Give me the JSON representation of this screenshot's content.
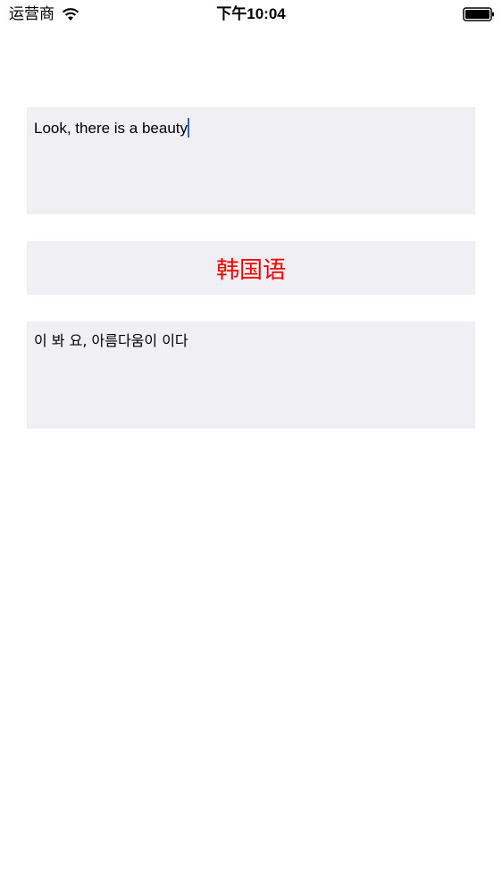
{
  "status_bar": {
    "carrier": "运营商",
    "time": "下午10:04",
    "icons": [
      "wifi-icon",
      "battery-icon"
    ]
  },
  "input": {
    "text": "Look, there is a beauty"
  },
  "language_button": {
    "label": "韩国语",
    "color": "#ff0000"
  },
  "output": {
    "text": "이 봐 요, 아름다움이 이다"
  },
  "colors": {
    "box_background": "#efeff4",
    "cursor": "#2f5fd8"
  }
}
